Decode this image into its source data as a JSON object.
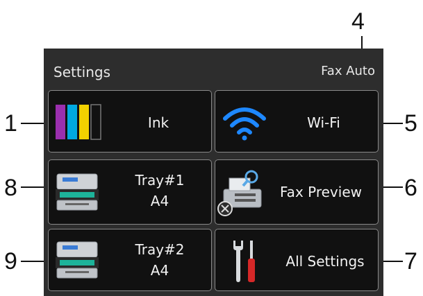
{
  "screen": {
    "title": "Settings",
    "fax_mode": "Fax Auto"
  },
  "tiles": {
    "ink": {
      "label": "Ink",
      "icon": "ink-cartridges-icon",
      "colors": [
        "#9b2fae",
        "#00a8e0",
        "#f2d100",
        "#111111"
      ]
    },
    "wifi": {
      "label": "Wi-Fi",
      "icon": "wifi-icon",
      "color": "#1e88ff"
    },
    "tray1": {
      "line1": "Tray#1",
      "line2": "A4",
      "icon": "printer-tray-icon"
    },
    "fax_preview": {
      "label": "Fax Preview",
      "icon": "fax-preview-icon"
    },
    "tray2": {
      "line1": "Tray#2",
      "line2": "A4",
      "icon": "printer-tray-icon"
    },
    "all_settings": {
      "label": "All Settings",
      "icon": "tools-icon"
    }
  },
  "callouts": [
    "1",
    "4",
    "5",
    "6",
    "7",
    "8",
    "9"
  ]
}
